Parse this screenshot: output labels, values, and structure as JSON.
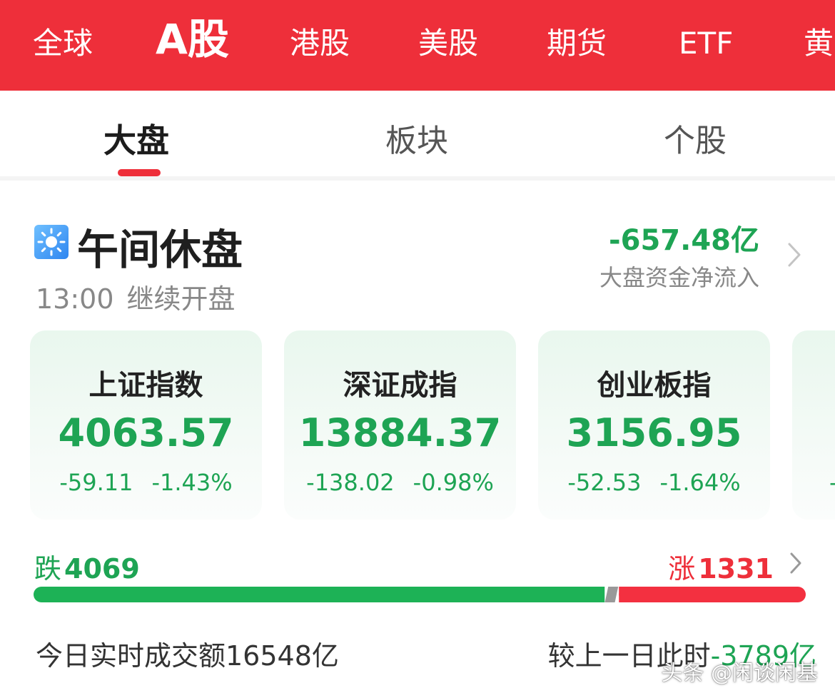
{
  "market_tabs": [
    {
      "label": "全球",
      "active": false
    },
    {
      "label": "A股",
      "active": true
    },
    {
      "label": "港股",
      "active": false
    },
    {
      "label": "美股",
      "active": false
    },
    {
      "label": "期货",
      "active": false
    },
    {
      "label": "ETF",
      "active": false
    },
    {
      "label": "黄",
      "active": false
    }
  ],
  "sub_tabs": [
    {
      "label": "大盘",
      "active": true
    },
    {
      "label": "板块",
      "active": false
    },
    {
      "label": "个股",
      "active": false
    }
  ],
  "status": {
    "icon": "sun-icon",
    "title": "午间休盘",
    "time": "13:00",
    "resume": "继续开盘"
  },
  "fund_flow": {
    "value": "-657.48亿",
    "label": "大盘资金净流入"
  },
  "indices": [
    {
      "name": "上证指数",
      "value": "4063.57",
      "change": "-59.11",
      "pct": "-1.43%"
    },
    {
      "name": "深证成指",
      "value": "13884.37",
      "change": "-138.02",
      "pct": "-0.98%"
    },
    {
      "name": "创业板指",
      "value": "3156.95",
      "change": "-52.53",
      "pct": "-1.64%"
    },
    {
      "name": "",
      "value": "",
      "change": "-",
      "pct": ""
    }
  ],
  "breadth": {
    "fall_label": "跌",
    "fall_count": "4069",
    "rise_label": "涨",
    "rise_count": "1331",
    "fall": 4069,
    "flat": 0,
    "rise": 1331
  },
  "turnover": {
    "text": "今日实时成交额16548亿",
    "compare_label": "较上一日此时",
    "compare_value": "-3789亿"
  },
  "watermark": "头条 @闲谈闲基",
  "colors": {
    "brand_red": "#ee2f3a",
    "down_green": "#1ea454",
    "flat_gray": "#999999"
  }
}
